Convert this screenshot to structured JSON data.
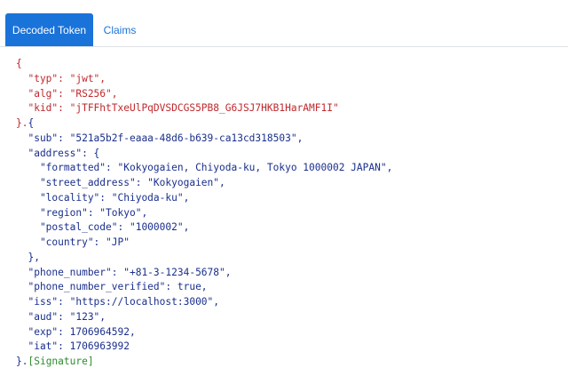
{
  "tabs": [
    {
      "label": "Decoded Token",
      "active": true
    },
    {
      "label": "Claims",
      "active": false
    }
  ],
  "colors": {
    "accent": "#1a73d9",
    "header_text": "#c0282d",
    "payload_text": "#1a2f8c",
    "signature_text": "#2e8b2e"
  },
  "token": {
    "header_lines": [
      "{",
      "  \"typ\": \"jwt\",",
      "  \"alg\": \"RS256\",",
      "  \"kid\": \"jTFFhtTxeUlPqDVSDCGS5PB8_G6JSJ7HKB1HarAMF1I\""
    ],
    "separator": "}.",
    "payload_lines": [
      "{",
      "  \"sub\": \"521a5b2f-eaaa-48d6-b639-ca13cd318503\",",
      "  \"address\": {",
      "    \"formatted\": \"Kokyogaien, Chiyoda-ku, Tokyo 1000002 JAPAN\",",
      "    \"street_address\": \"Kokyogaien\",",
      "    \"locality\": \"Chiyoda-ku\",",
      "    \"region\": \"Tokyo\",",
      "    \"postal_code\": \"1000002\",",
      "    \"country\": \"JP\"",
      "  },",
      "  \"phone_number\": \"+81-3-1234-5678\",",
      "  \"phone_number_verified\": true,",
      "  \"iss\": \"https://localhost:3000\",",
      "  \"aud\": \"123\",",
      "  \"exp\": 1706964592,",
      "  \"iat\": 1706963992"
    ],
    "closing": "}.",
    "signature": "[Signature]"
  }
}
